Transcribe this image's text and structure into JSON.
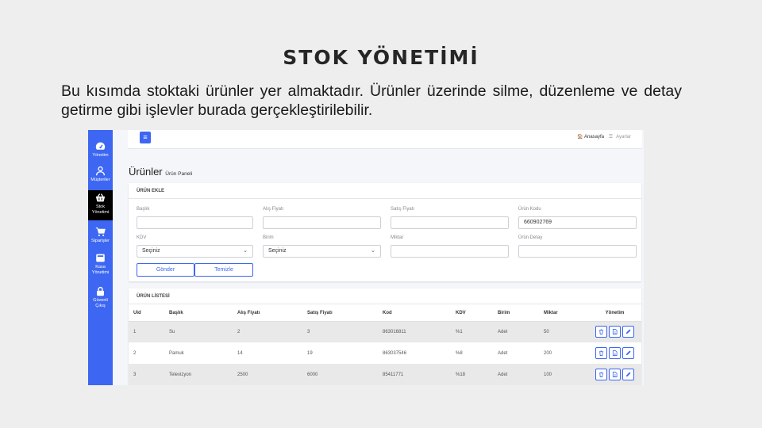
{
  "slide": {
    "title": "STOK YÖNETİMİ",
    "description": "Bu kısımda stoktaki ürünler yer almaktadır. Ürünler üzerinde silme, düzenleme ve detay getirme gibi işlevler burada gerçekleştirilebilir."
  },
  "sidebar": {
    "items": [
      {
        "label": "Yönetim",
        "icon": "dashboard-icon"
      },
      {
        "label": "Müşteriler",
        "icon": "user-icon"
      },
      {
        "label": "Stok Yönetimi",
        "icon": "basket-icon",
        "active": true
      },
      {
        "label": "Siparişler",
        "icon": "cart-icon"
      },
      {
        "label": "Kasa Yönetimi",
        "icon": "cash-register-icon"
      },
      {
        "label": "Güvenli Çıkış",
        "icon": "lock-icon"
      }
    ]
  },
  "topbar": {
    "menu_icon": "≡",
    "home_link": "Anasayfa",
    "settings_link": "Ayarlar"
  },
  "page": {
    "title": "Ürünler",
    "subtitle": "Ürün Paneli"
  },
  "add_form": {
    "header": "ÜRÜN EKLE",
    "fields": {
      "title_label": "Başlık",
      "title_value": "",
      "buy_price_label": "Alış Fiyatı",
      "buy_price_value": "",
      "sell_price_label": "Satış Fiyatı",
      "sell_price_value": "",
      "code_label": "Ürün Kodu",
      "code_value": "660902769",
      "kdv_label": "KDV",
      "kdv_selected": "Seçiniz",
      "unit_label": "Birim",
      "unit_selected": "Seçiniz",
      "quantity_label": "Miktar",
      "quantity_value": "",
      "detail_label": "Ürün Detay",
      "detail_value": ""
    },
    "submit_label": "Gönder",
    "clear_label": "Temizle"
  },
  "list": {
    "header": "ÜRÜN LİSTESİ",
    "columns": [
      "Uid",
      "Başlık",
      "Alış Fiyatı",
      "Satış Fiyatı",
      "Kod",
      "KDV",
      "Birim",
      "Miktar",
      "Yönetim"
    ],
    "rows": [
      [
        "1",
        "Su",
        "2",
        "3",
        "863016811",
        "%1",
        "Adet",
        "50"
      ],
      [
        "2",
        "Pamuk",
        "14",
        "19",
        "863037546",
        "%8",
        "Adet",
        "200"
      ],
      [
        "3",
        "Televizyon",
        "2500",
        "6000",
        "85411771",
        "%18",
        "Adet",
        "100"
      ]
    ],
    "actions": [
      "trash-icon",
      "file-icon",
      "pencil-icon"
    ]
  },
  "colors": {
    "accent": "#3d67f2",
    "sidebar_active": "#000000",
    "row_stripe": "#e9e9e9"
  }
}
